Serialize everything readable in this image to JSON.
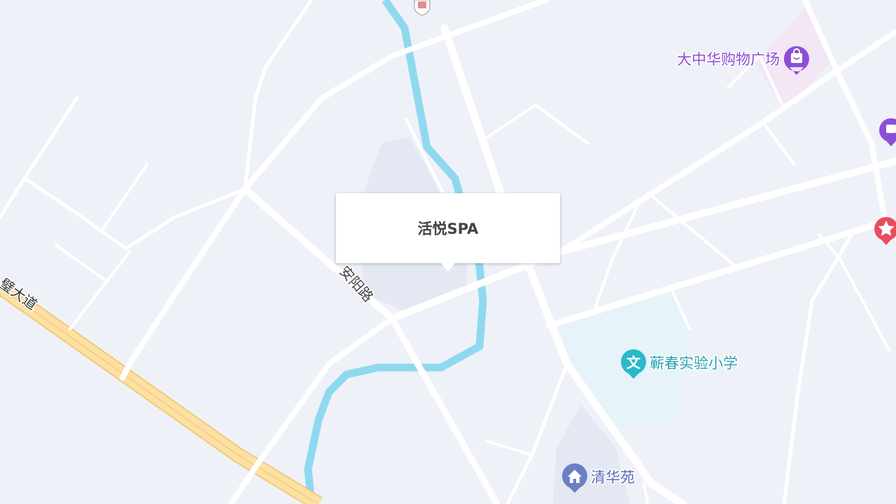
{
  "popup": {
    "title": "活悦SPA"
  },
  "roads": {
    "anyang": "安阳路",
    "expressway": "璧大道"
  },
  "pois": {
    "mall": {
      "name": "大中华购物广场",
      "icon": "shopping-bag-icon",
      "color": "#8b4fd6"
    },
    "school": {
      "name": "蕲春实验小学",
      "icon": "school-wen-icon",
      "color": "#2bb9c9"
    },
    "residential": {
      "name": "清华苑",
      "icon": "residential-icon",
      "color": "#6b7fc4"
    },
    "shop_edge": {
      "icon": "shopping-bag-icon",
      "color": "#8b4fd6"
    },
    "star_edge": {
      "icon": "star-icon",
      "color": "#e84d5f"
    },
    "top_marker": {
      "icon": "shop-marker-icon"
    }
  },
  "colors": {
    "background": "#eef1f8",
    "road": "#ffffff",
    "expressway": "#fbd98f",
    "river": "#8fd9f0"
  }
}
